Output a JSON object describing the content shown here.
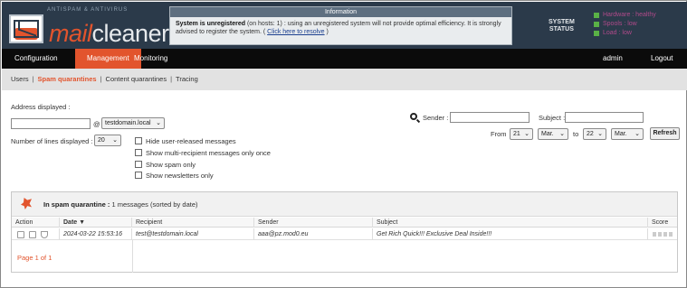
{
  "header": {
    "logo_tagline": "ANTISPAM & ANTIVIRUS",
    "logo_mail": "mail",
    "logo_cleaner": "cleaner",
    "info_title": "Information",
    "info_bold": "System is unregistered",
    "info_text": " (on hosts: 1) : using an unregistered system will not provide optimal efficiency. It is strongly advised to register the system. ( ",
    "info_link": "Click here to resolve",
    "info_close": " )",
    "system_status_line1": "SYSTEM",
    "system_status_line2": "STATUS",
    "status_items": [
      "Hardware : healthy",
      "Spools : low",
      "Load : low"
    ],
    "status_color": "#5ab146",
    "status_text_color": "#b04a8a"
  },
  "menu": {
    "items": [
      "Configuration",
      "Management",
      "Monitoring"
    ],
    "active": "Management",
    "user": "admin",
    "logout": "Logout",
    "accent": "#e2542d"
  },
  "submenu": {
    "items": [
      "Users",
      "Spam quarantines",
      "Content quarantines",
      "Tracing"
    ],
    "active": "Spam quarantines"
  },
  "filters": {
    "address_label": "Address displayed :",
    "address_value": "",
    "at": "@",
    "domain": "testdomain.local",
    "lines_label": "Number of lines displayed :",
    "lines_value": "20",
    "checkboxes": [
      "Hide user-released messages",
      "Show multi-recipient messages only once",
      "Show spam only",
      "Show newsletters only"
    ],
    "sender_label": "Sender :",
    "sender_value": "",
    "subject_label": "Subject :",
    "subject_value": "",
    "from_label": "From",
    "from_day": "21",
    "from_month": "Mar.",
    "to_label": "to",
    "to_day": "22",
    "to_month": "Mar.",
    "refresh": "Refresh"
  },
  "results": {
    "heading_bold": "In spam quarantine :",
    "heading_rest": " 1 messages (sorted by date)",
    "columns": [
      "Action",
      "Date ▼",
      "Recipient",
      "Sender",
      "Subject",
      "Score"
    ],
    "rows": [
      {
        "date": "2024-03-22  15:53:16",
        "recipient": "test@testdomain.local",
        "sender": "aaa@pz.mod0.eu",
        "subject": "Get Rich Quick!!! Exclusive Deal Inside!!!"
      }
    ],
    "pager": "Page 1 of 1"
  }
}
